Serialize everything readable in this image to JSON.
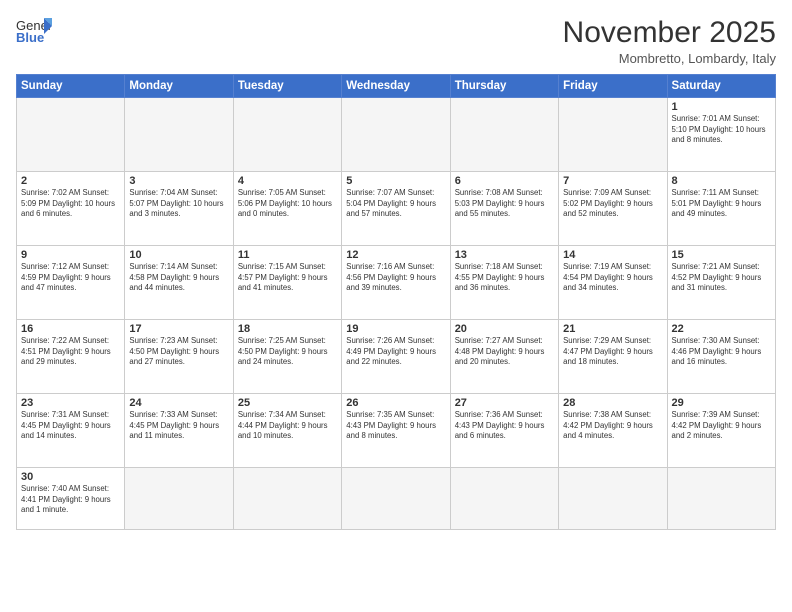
{
  "logo": {
    "text_general": "General",
    "text_blue": "Blue"
  },
  "header": {
    "month_year": "November 2025",
    "location": "Mombretto, Lombardy, Italy"
  },
  "weekdays": [
    "Sunday",
    "Monday",
    "Tuesday",
    "Wednesday",
    "Thursday",
    "Friday",
    "Saturday"
  ],
  "weeks": [
    [
      {
        "day": "",
        "info": "",
        "empty": true
      },
      {
        "day": "",
        "info": "",
        "empty": true
      },
      {
        "day": "",
        "info": "",
        "empty": true
      },
      {
        "day": "",
        "info": "",
        "empty": true
      },
      {
        "day": "",
        "info": "",
        "empty": true
      },
      {
        "day": "",
        "info": "",
        "empty": true
      },
      {
        "day": "1",
        "info": "Sunrise: 7:01 AM\nSunset: 5:10 PM\nDaylight: 10 hours and 8 minutes.",
        "empty": false
      }
    ],
    [
      {
        "day": "2",
        "info": "Sunrise: 7:02 AM\nSunset: 5:09 PM\nDaylight: 10 hours and 6 minutes.",
        "empty": false
      },
      {
        "day": "3",
        "info": "Sunrise: 7:04 AM\nSunset: 5:07 PM\nDaylight: 10 hours and 3 minutes.",
        "empty": false
      },
      {
        "day": "4",
        "info": "Sunrise: 7:05 AM\nSunset: 5:06 PM\nDaylight: 10 hours and 0 minutes.",
        "empty": false
      },
      {
        "day": "5",
        "info": "Sunrise: 7:07 AM\nSunset: 5:04 PM\nDaylight: 9 hours and 57 minutes.",
        "empty": false
      },
      {
        "day": "6",
        "info": "Sunrise: 7:08 AM\nSunset: 5:03 PM\nDaylight: 9 hours and 55 minutes.",
        "empty": false
      },
      {
        "day": "7",
        "info": "Sunrise: 7:09 AM\nSunset: 5:02 PM\nDaylight: 9 hours and 52 minutes.",
        "empty": false
      },
      {
        "day": "8",
        "info": "Sunrise: 7:11 AM\nSunset: 5:01 PM\nDaylight: 9 hours and 49 minutes.",
        "empty": false
      }
    ],
    [
      {
        "day": "9",
        "info": "Sunrise: 7:12 AM\nSunset: 4:59 PM\nDaylight: 9 hours and 47 minutes.",
        "empty": false
      },
      {
        "day": "10",
        "info": "Sunrise: 7:14 AM\nSunset: 4:58 PM\nDaylight: 9 hours and 44 minutes.",
        "empty": false
      },
      {
        "day": "11",
        "info": "Sunrise: 7:15 AM\nSunset: 4:57 PM\nDaylight: 9 hours and 41 minutes.",
        "empty": false
      },
      {
        "day": "12",
        "info": "Sunrise: 7:16 AM\nSunset: 4:56 PM\nDaylight: 9 hours and 39 minutes.",
        "empty": false
      },
      {
        "day": "13",
        "info": "Sunrise: 7:18 AM\nSunset: 4:55 PM\nDaylight: 9 hours and 36 minutes.",
        "empty": false
      },
      {
        "day": "14",
        "info": "Sunrise: 7:19 AM\nSunset: 4:54 PM\nDaylight: 9 hours and 34 minutes.",
        "empty": false
      },
      {
        "day": "15",
        "info": "Sunrise: 7:21 AM\nSunset: 4:52 PM\nDaylight: 9 hours and 31 minutes.",
        "empty": false
      }
    ],
    [
      {
        "day": "16",
        "info": "Sunrise: 7:22 AM\nSunset: 4:51 PM\nDaylight: 9 hours and 29 minutes.",
        "empty": false
      },
      {
        "day": "17",
        "info": "Sunrise: 7:23 AM\nSunset: 4:50 PM\nDaylight: 9 hours and 27 minutes.",
        "empty": false
      },
      {
        "day": "18",
        "info": "Sunrise: 7:25 AM\nSunset: 4:50 PM\nDaylight: 9 hours and 24 minutes.",
        "empty": false
      },
      {
        "day": "19",
        "info": "Sunrise: 7:26 AM\nSunset: 4:49 PM\nDaylight: 9 hours and 22 minutes.",
        "empty": false
      },
      {
        "day": "20",
        "info": "Sunrise: 7:27 AM\nSunset: 4:48 PM\nDaylight: 9 hours and 20 minutes.",
        "empty": false
      },
      {
        "day": "21",
        "info": "Sunrise: 7:29 AM\nSunset: 4:47 PM\nDaylight: 9 hours and 18 minutes.",
        "empty": false
      },
      {
        "day": "22",
        "info": "Sunrise: 7:30 AM\nSunset: 4:46 PM\nDaylight: 9 hours and 16 minutes.",
        "empty": false
      }
    ],
    [
      {
        "day": "23",
        "info": "Sunrise: 7:31 AM\nSunset: 4:45 PM\nDaylight: 9 hours and 14 minutes.",
        "empty": false
      },
      {
        "day": "24",
        "info": "Sunrise: 7:33 AM\nSunset: 4:45 PM\nDaylight: 9 hours and 11 minutes.",
        "empty": false
      },
      {
        "day": "25",
        "info": "Sunrise: 7:34 AM\nSunset: 4:44 PM\nDaylight: 9 hours and 10 minutes.",
        "empty": false
      },
      {
        "day": "26",
        "info": "Sunrise: 7:35 AM\nSunset: 4:43 PM\nDaylight: 9 hours and 8 minutes.",
        "empty": false
      },
      {
        "day": "27",
        "info": "Sunrise: 7:36 AM\nSunset: 4:43 PM\nDaylight: 9 hours and 6 minutes.",
        "empty": false
      },
      {
        "day": "28",
        "info": "Sunrise: 7:38 AM\nSunset: 4:42 PM\nDaylight: 9 hours and 4 minutes.",
        "empty": false
      },
      {
        "day": "29",
        "info": "Sunrise: 7:39 AM\nSunset: 4:42 PM\nDaylight: 9 hours and 2 minutes.",
        "empty": false
      }
    ],
    [
      {
        "day": "30",
        "info": "Sunrise: 7:40 AM\nSunset: 4:41 PM\nDaylight: 9 hours and 1 minute.",
        "empty": false
      },
      {
        "day": "",
        "info": "",
        "empty": true
      },
      {
        "day": "",
        "info": "",
        "empty": true
      },
      {
        "day": "",
        "info": "",
        "empty": true
      },
      {
        "day": "",
        "info": "",
        "empty": true
      },
      {
        "day": "",
        "info": "",
        "empty": true
      },
      {
        "day": "",
        "info": "",
        "empty": true
      }
    ]
  ]
}
